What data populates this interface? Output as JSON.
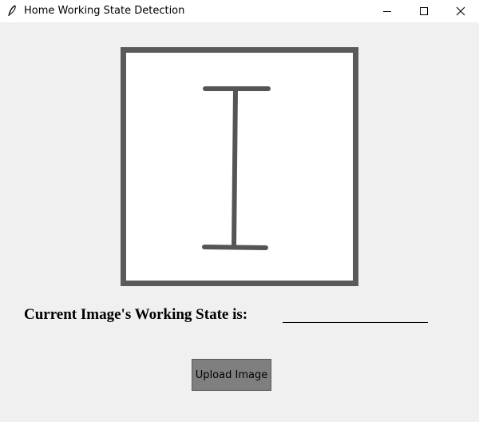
{
  "window": {
    "title": "Home Working State Detection",
    "app_icon": "feather-icon",
    "controls": [
      "minimize-icon",
      "maximize-icon",
      "close-icon"
    ]
  },
  "image_display": {
    "content": "cursor-i-beam-icon",
    "frame_color": "#5a5a5a",
    "background": "#ffffff"
  },
  "state": {
    "label": "Current Image's Working State is:",
    "value": ""
  },
  "actions": {
    "upload_label": "Upload Image",
    "upload_color": "#7f7f7f"
  }
}
